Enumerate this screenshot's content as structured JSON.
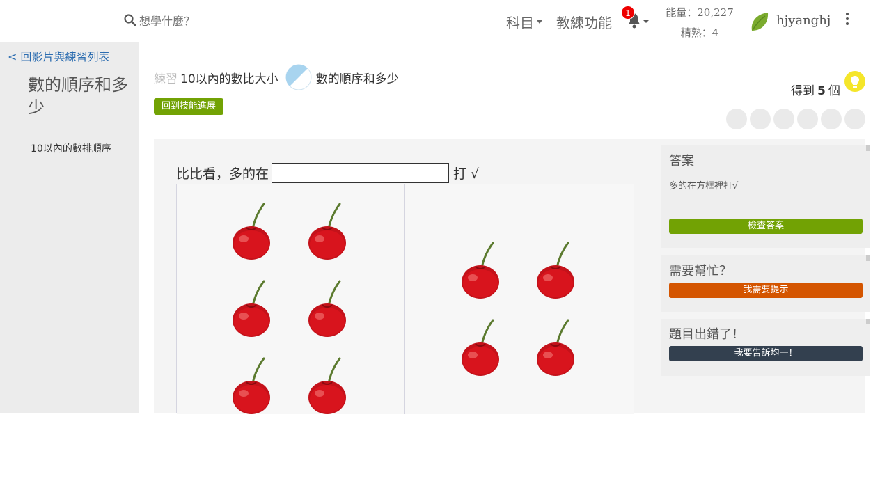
{
  "header": {
    "search_placeholder": "想學什麼？",
    "nav_subjects": "科目",
    "nav_coach": "教練功能",
    "notification_count": "1",
    "energy": "能量：20,227",
    "mastery": "精熟：4",
    "username": "hjyanghj"
  },
  "sidebar": {
    "back_link": "< 回影片與練習列表",
    "title": "數的順序和多少",
    "item": "10以內的數排順序"
  },
  "exercise": {
    "label": "練習",
    "skill": "10以內的數比大小",
    "name": "數的順序和多少",
    "back_button": "回到技能進展",
    "earn_prefix": "得到",
    "earn_count": "5",
    "earn_suffix": "個",
    "streak_total": 6
  },
  "problem": {
    "question_prefix": "比比看，多的在",
    "question_suffix": "打 √",
    "left_count": 6,
    "right_count": 4
  },
  "panels": {
    "answer_title": "答案",
    "answer_text": "多的在方框裡打√",
    "check_button": "檢查答案",
    "help_title": "需要幫忙？",
    "hint_button": "我需要提示",
    "report_title": "題目出錯了！",
    "report_button": "我要告訴均一！"
  },
  "colors": {
    "green": "#72a204",
    "orange": "#d45500",
    "dark": "#33404f",
    "badge": "#e00000"
  }
}
